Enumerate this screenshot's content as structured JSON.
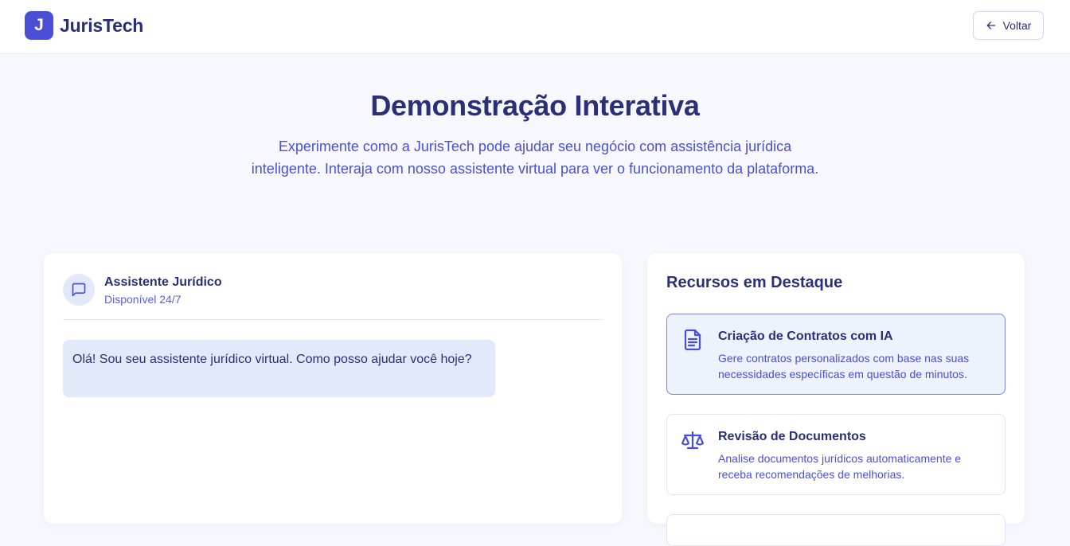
{
  "header": {
    "logo_letter": "J",
    "brand": "JurisTech",
    "back_label": "Voltar"
  },
  "hero": {
    "title": "Demonstração Interativa",
    "subtitle": "Experimente como a JurisTech pode ajudar seu negócio com assistência jurídica inteligente. Interaja com nosso assistente virtual para ver o funcionamento da plataforma."
  },
  "chat": {
    "name": "Assistente Jurídico",
    "status": "Disponível 24/7",
    "avatar_icon": "message-square-icon",
    "messages": [
      {
        "from": "assistant",
        "text": "Olá! Sou seu assistente jurídico virtual. Como posso ajudar você hoje?"
      }
    ]
  },
  "resources": {
    "title": "Recursos em Destaque",
    "items": [
      {
        "title": "Criação de Contratos com IA",
        "description": "Gere contratos personalizados com base nas suas necessidades específicas em questão de minutos.",
        "icon": "document-icon",
        "active": true
      },
      {
        "title": "Revisão de Documentos",
        "description": "Analise documentos jurídicos automaticamente e receba recomendações de melhorias.",
        "icon": "scale-icon",
        "active": false
      }
    ]
  },
  "colors": {
    "primary": "#4b4fd6",
    "text_dark": "#2a2f78",
    "bubble_bg": "#e2e9fb",
    "page_bg": "#f6f8fd"
  }
}
